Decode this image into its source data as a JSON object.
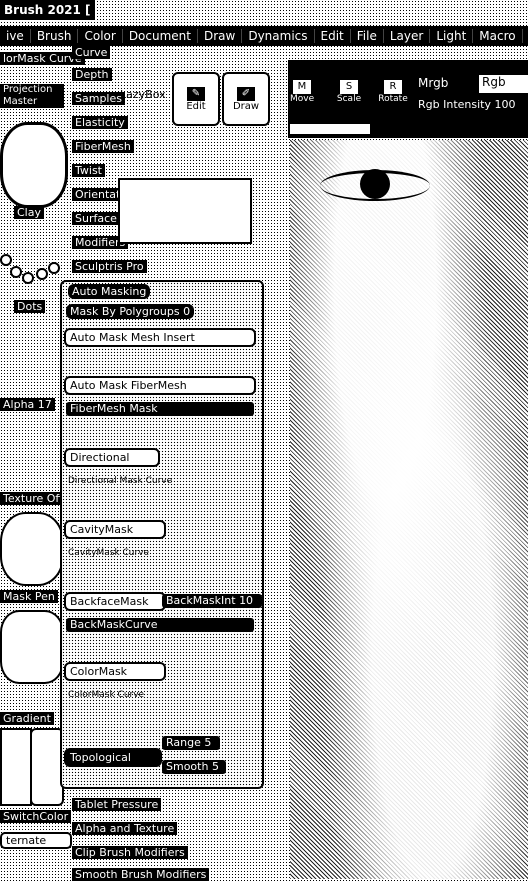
{
  "app": {
    "title": "Brush 2021 ["
  },
  "menus": [
    "ive",
    "Brush",
    "Color",
    "Document",
    "Draw",
    "Dynamics",
    "Edit",
    "File",
    "Layer",
    "Light",
    "Macro"
  ],
  "left": {
    "color_mask_curve": "lorMask Curve",
    "projection_master": "Projection Master",
    "clay_label": "Clay",
    "dots_label": "Dots",
    "alpha_label": "Alpha 17",
    "texture_label": "Texture Off",
    "material_label": "Mask Pen",
    "gradient_label": "Gradient",
    "switch_color": "SwitchColor",
    "alternate": "ternate"
  },
  "brush_menu": {
    "items": [
      "Curve",
      "Depth",
      "Samples",
      "Elasticity",
      "FiberMesh",
      "Twist",
      "Orientation",
      "Surface",
      "Modifiers",
      "Sculptris Pro"
    ],
    "lazy_label": "LazyBox",
    "bottom_items": [
      "Tablet Pressure",
      "Alpha and Texture",
      "Clip Brush Modifiers",
      "Smooth Brush Modifiers"
    ]
  },
  "auto_masking": {
    "header": "Auto Masking",
    "mask_by_polygroups": "Mask By Polygroups 0",
    "mesh_insert": "Auto Mask Mesh Insert",
    "fibermesh": "Auto Mask FiberMesh",
    "fibermesh_mask": "FiberMesh Mask",
    "directional": "Directional",
    "directional_sub": "Directional Mask Curve",
    "cavity_mask": "CavityMask",
    "cavity_sub": "CavityMask Curve",
    "backface_mask": "BackfaceMask",
    "back_mask_int": "BackMaskInt 10",
    "back_mask_curve": "BackMaskCurve",
    "color_mask": "ColorMask",
    "color_sub": "ColorMask Curve",
    "topological": "Topological",
    "range": "Range 5",
    "smooth": "Smooth 5"
  },
  "toolbar": {
    "edit": "Edit",
    "draw": "Draw",
    "move": "Move",
    "scale": "Scale",
    "rotate": "Rotate",
    "mrgb": "Mrgb",
    "rgb": "Rgb",
    "rgb_intensity": "Rgb Intensity 100"
  }
}
